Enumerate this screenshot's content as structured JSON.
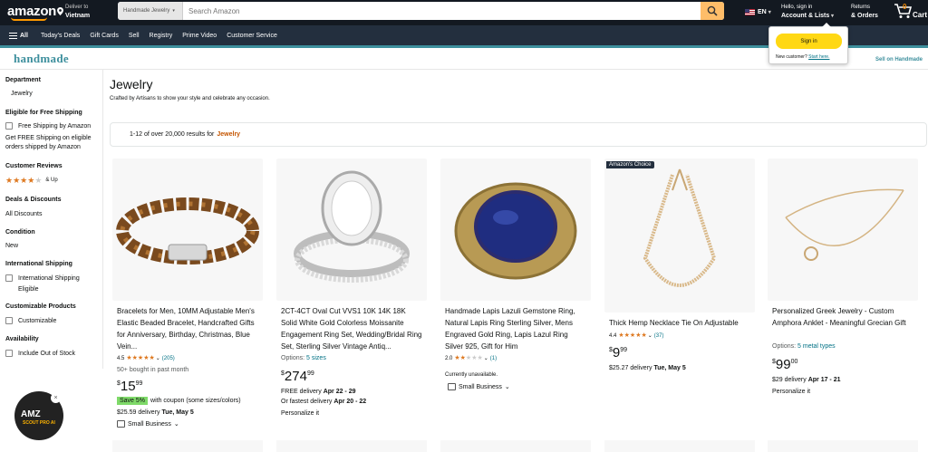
{
  "header": {
    "logo": "amazon",
    "deliver_small": "Deliver to",
    "deliver_big": "Vietnam",
    "search_category": "Handmade Jewelry",
    "search_placeholder": "Search Amazon",
    "lang": "EN",
    "account_small": "Hello, sign in",
    "account_big": "Account & Lists",
    "returns_small": "Returns",
    "returns_big": "& Orders",
    "cart_count": "0",
    "cart_label": "Cart"
  },
  "subnav": {
    "all": "All",
    "links": [
      "Today's Deals",
      "Gift Cards",
      "Sell",
      "Registry",
      "Prime Video",
      "Customer Service"
    ]
  },
  "handmade": {
    "logo": "handmade",
    "sell": "Sell on Handmade"
  },
  "popover": {
    "signin": "Sign in",
    "new_customer": "New customer?",
    "start_here": "Start here."
  },
  "sidebar": {
    "department_h": "Department",
    "department_item": "Jewelry",
    "free_ship_h": "Eligible for Free Shipping",
    "free_ship_cb": "Free Shipping by Amazon",
    "free_ship_note_1": "Get FREE Shipping on eligible",
    "free_ship_note_2": "orders shipped by Amazon",
    "reviews_h": "Customer Reviews",
    "reviews_up": "& Up",
    "deals_h": "Deals & Discounts",
    "deals_item": "All Discounts",
    "condition_h": "Condition",
    "condition_item": "New",
    "intl_h": "International Shipping",
    "intl_cb_1": "International Shipping",
    "intl_cb_2": "Eligible",
    "custom_h": "Customizable Products",
    "custom_cb": "Customizable",
    "avail_h": "Availability",
    "avail_cb": "Include Out of Stock",
    "reviews_stars": 4
  },
  "page": {
    "title": "Jewelry",
    "subtitle": "Crafted by Artisans to show your style and celebrate any occasion.",
    "results_text": "1-12 of over 20,000 results for",
    "results_kw": "Jewelry"
  },
  "products": [
    {
      "title": "Bracelets for Men, 10MM Adjustable Men's Elastic Beaded Bracelet, Handcrafted Gifts for Anniversary, Birthday, Christmas, Blue Vein...",
      "rating": "4.5",
      "stars": 4.5,
      "count": "(205)",
      "bought": "50+ bought in past month",
      "price_sym": "$",
      "price_whole": "15",
      "price_frac": "99",
      "coupon_tag": "Save 5%",
      "coupon_text": "with coupon (some sizes/colors)",
      "delivery": "$25.59 delivery",
      "delivery_date": "Tue, May 5",
      "small_business": "Small Business"
    },
    {
      "title": "2CT-4CT Oval Cut VVS1 10K 14K 18K Solid White Gold Colorless Moissanite Engagement Ring Set, Wedding/Bridal Ring Set, Sterling Silver Vintage Antiq...",
      "options_label": "Options:",
      "options_link": "5 sizes",
      "price_sym": "$",
      "price_whole": "274",
      "price_frac": "99",
      "delivery": "FREE delivery",
      "delivery_date": "Apr 22 - 29",
      "fastest": "Or fastest delivery",
      "fastest_date": "Apr 20 - 22",
      "personalize": "Personalize it"
    },
    {
      "title": "Handmade Lapis Lazuli Gemstone Ring, Natural Lapis Ring Sterling Silver, Mens Engraved Gold Ring, Lapis Lazul Ring Silver 925, Gift for Him",
      "rating": "2.0",
      "stars": 2,
      "count": "(1)",
      "unavailable": "Currently unavailable.",
      "small_business": "Small Business"
    },
    {
      "badge": "Amazon's Choice",
      "title": "Thick Hemp Necklace Tie On Adjustable",
      "rating": "4.4",
      "stars": 4.4,
      "count": "(37)",
      "price_sym": "$",
      "price_whole": "9",
      "price_frac": "99",
      "delivery": "$25.27 delivery",
      "delivery_date": "Tue, May 5"
    },
    {
      "title": "Personalized Greek Jewelry - Custom Amphora Anklet - Meaningful Grecian Gift",
      "options_label": "Options:",
      "options_link": "5 metal types",
      "price_sym": "$",
      "price_whole": "99",
      "price_frac": "00",
      "delivery": "$29 delivery",
      "delivery_date": "Apr 17 - 21",
      "personalize": "Personalize it"
    }
  ],
  "extension": {
    "name": "AMZ",
    "sub": "SCOUT PRO AI",
    "close": "×"
  },
  "colors": {
    "nav": "#131921",
    "subnav": "#232f3e",
    "search_btn": "#febd69",
    "star": "#de7921",
    "link": "#007185",
    "handmade": "#3d8f9d",
    "signin_btn": "#ffd814",
    "coupon": "#7fda69"
  }
}
